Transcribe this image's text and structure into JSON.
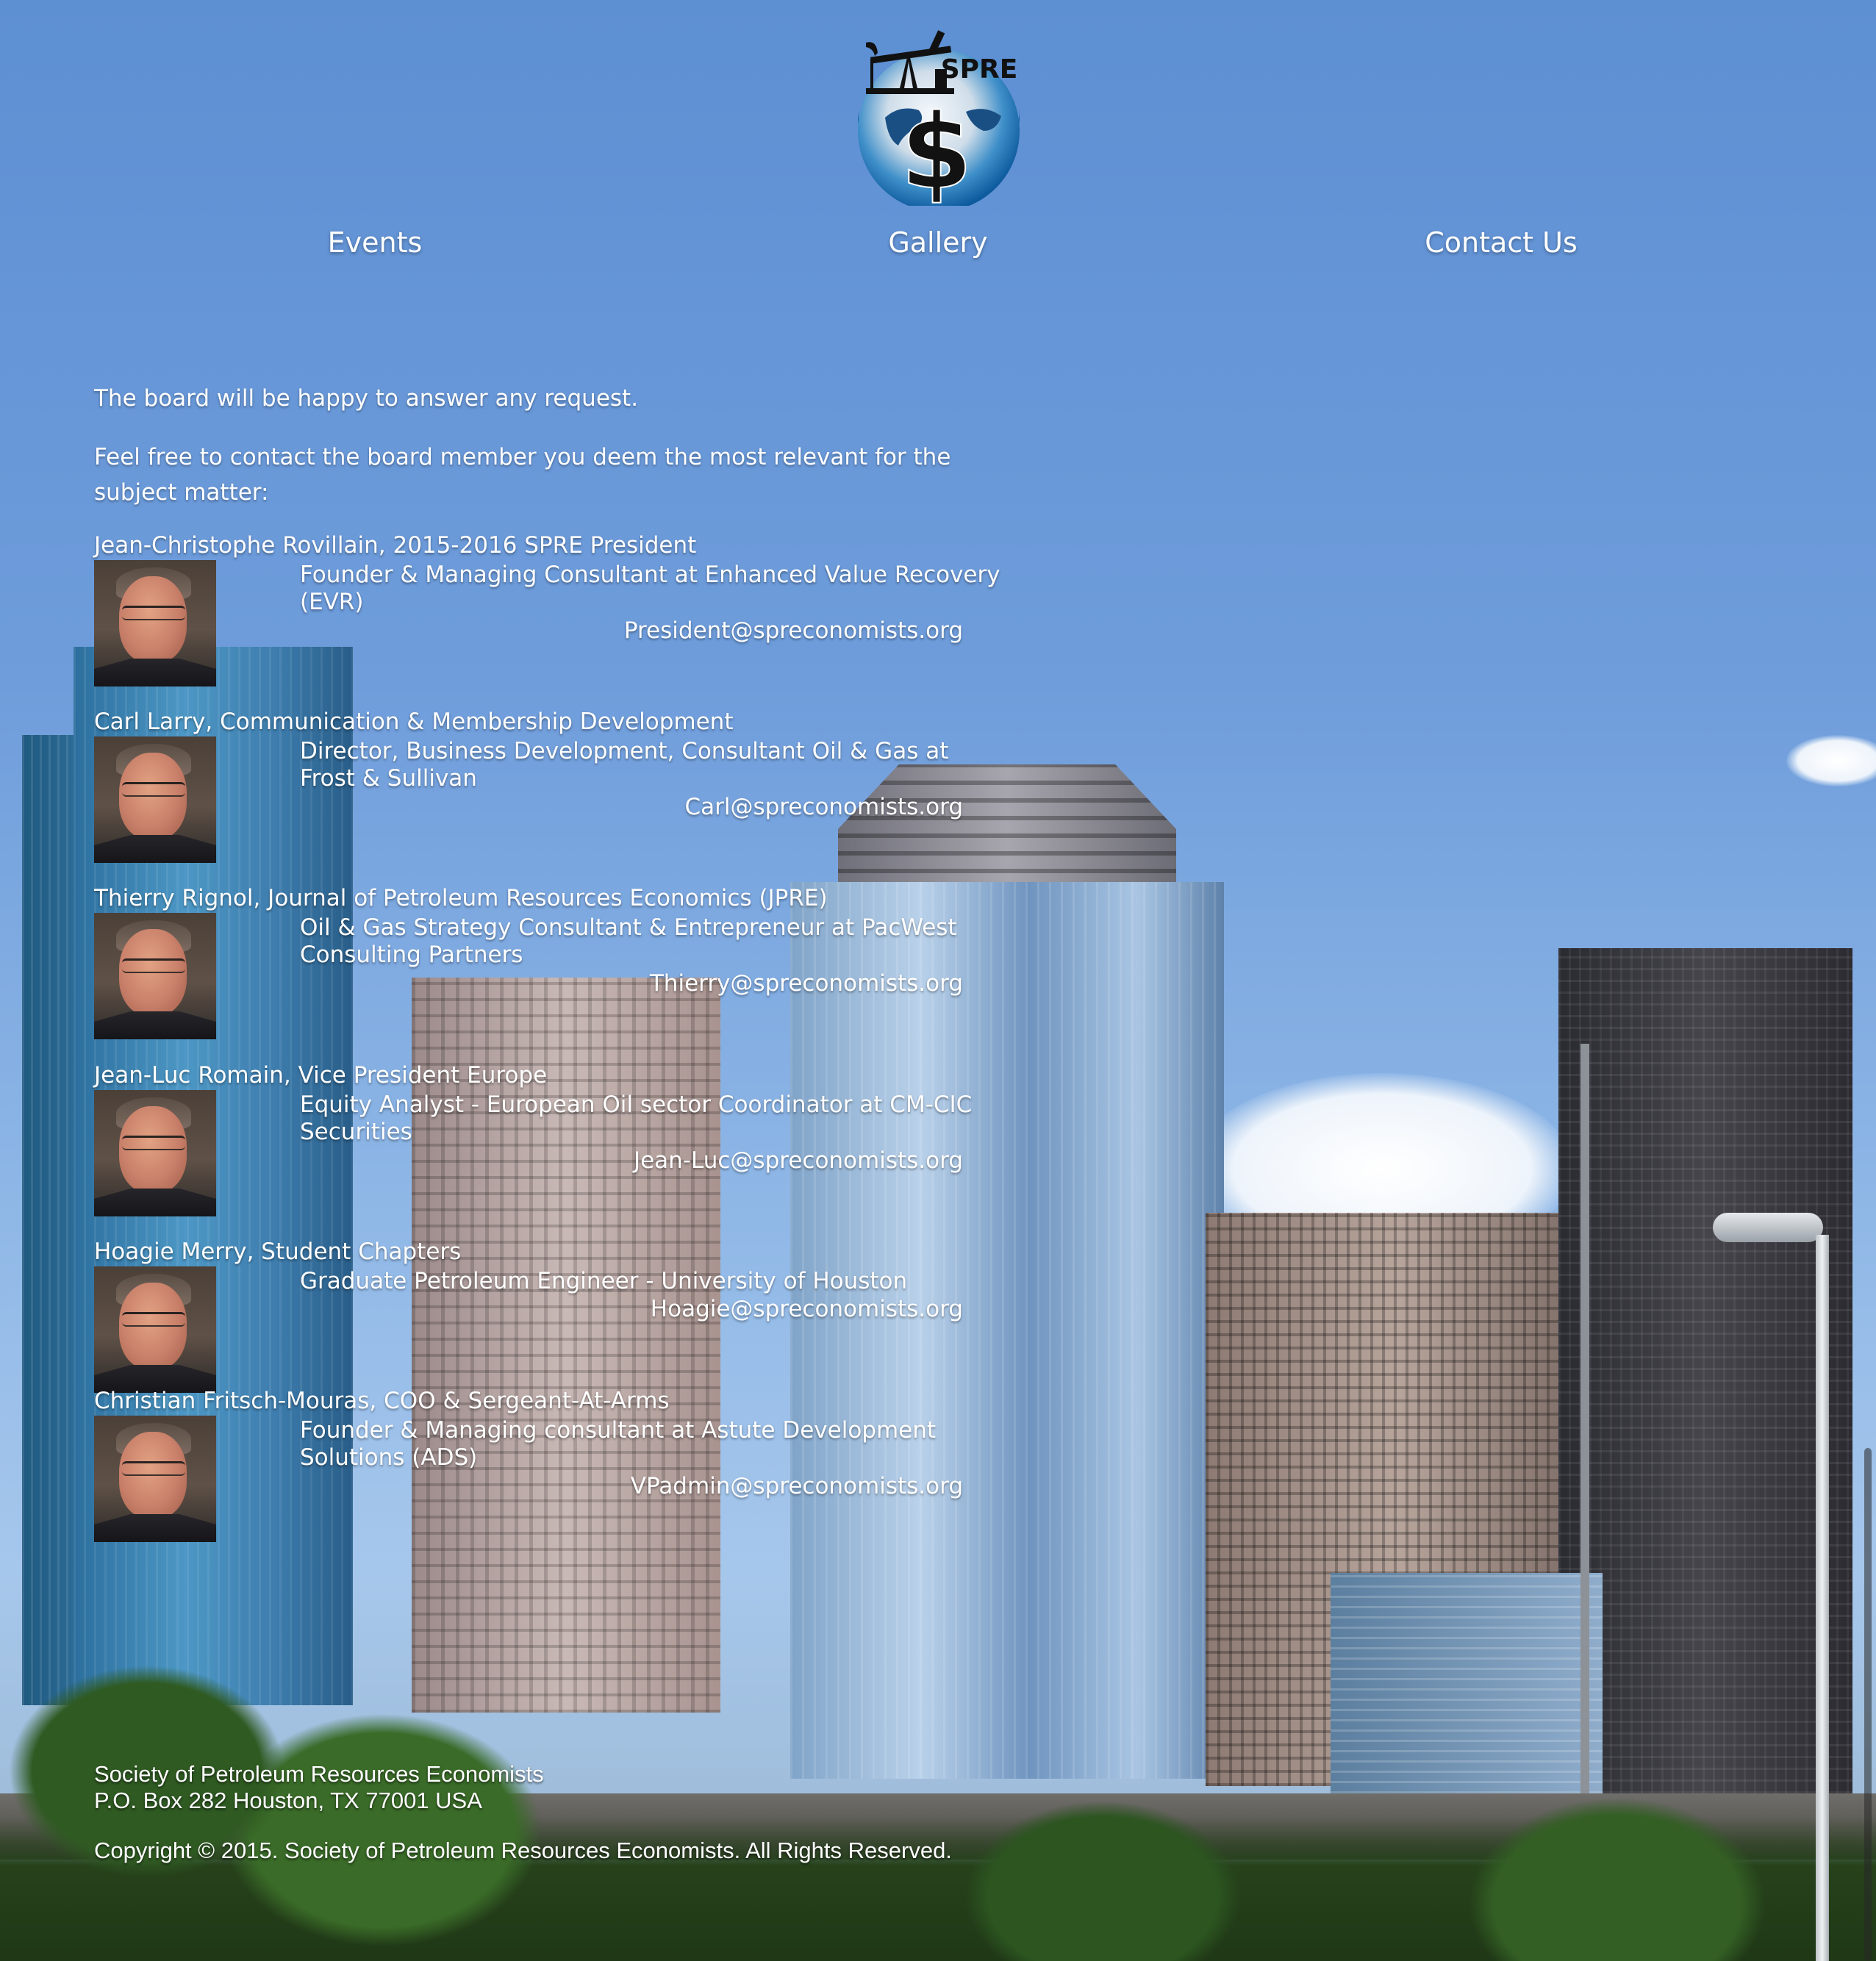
{
  "logo": {
    "text": "SPRE",
    "icon": "oil-pumpjack-globe-dollar-icon"
  },
  "nav": [
    {
      "label": "Events"
    },
    {
      "label": "Gallery"
    },
    {
      "label": "Contact Us"
    }
  ],
  "intro": {
    "line1": "The board will be happy to answer any request.",
    "line2": "Feel free to contact the board member you deem the most relevant for the subject matter:"
  },
  "members": [
    {
      "name": "Jean-Christophe Rovillain, 2015-2016 SPRE President",
      "role": "Founder & Managing Consultant at Enhanced Value Recovery (EVR)",
      "email": "President@spreconomists.org"
    },
    {
      "name": "Carl Larry, Communication & Membership Development",
      "role": "Director, Business Development, Consultant Oil & Gas at Frost & Sullivan",
      "email": "Carl@spreconomists.org"
    },
    {
      "name": "Thierry Rignol, Journal of Petroleum Resources Economics (JPRE)",
      "role": "Oil & Gas Strategy Consultant & Entrepreneur at PacWest Consulting Partners",
      "email": "Thierry@spreconomists.org"
    },
    {
      "name": "Jean-Luc Romain, Vice President Europe",
      "role": "Equity Analyst - European Oil sector Coordinator at CM-CIC Securities",
      "email": "Jean-Luc@spreconomists.org"
    },
    {
      "name": "Hoagie Merry, Student Chapters",
      "role": "Graduate Petroleum Engineer - University of Houston",
      "email": "Hoagie@spreconomists.org"
    },
    {
      "name": "Christian Fritsch-Mouras, COO & Sergeant-At-Arms",
      "role": "Founder & Managing consultant at Astute Development Solutions (ADS)",
      "email": "VPadmin@spreconomists.org"
    }
  ],
  "footer": {
    "org": "Society of Petroleum Resources Economists",
    "address": "P.O. Box 282 Houston, TX 77001 USA",
    "copyright": "Copyright © 2015. Society of Petroleum Resources Economists. All Rights Reserved."
  }
}
